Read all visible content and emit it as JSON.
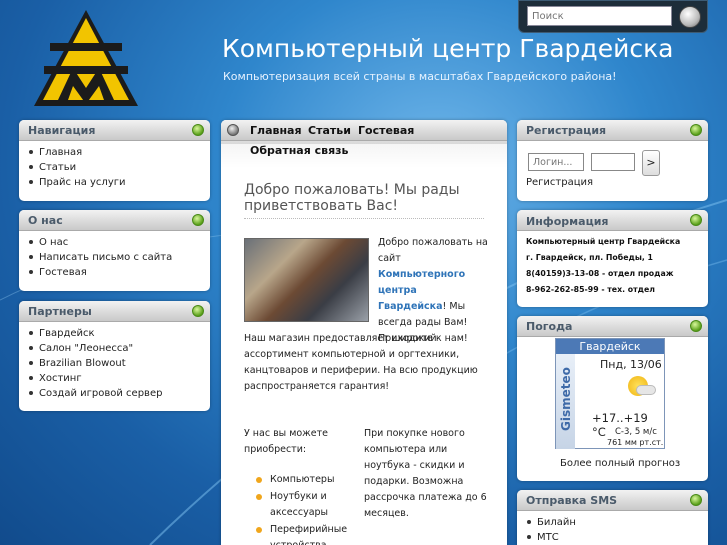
{
  "site": {
    "title": "Компьютерный центр Гвардейска",
    "subtitle": "Компьютеризация всей страны в масштабах Гвардейского района!"
  },
  "search": {
    "placeholder": "Поиск"
  },
  "nav_box": {
    "title": "Навигация",
    "items": [
      "Главная",
      "Статьи",
      "Прайс на услуги"
    ]
  },
  "about_box": {
    "title": "О нас",
    "items": [
      "О нас",
      "Написать письмо с сайта",
      "Гостевая"
    ]
  },
  "partners_box": {
    "title": "Партнеры",
    "items": [
      "Гвардейск",
      "Салон \"Леонесса\"",
      "Brazilian Blowout",
      "Хостинг",
      "Создай игровой сервер"
    ]
  },
  "main_nav": {
    "items": [
      "Главная",
      "Статьи",
      "Гостевая",
      "Обратная связь"
    ]
  },
  "article": {
    "heading": "Добро пожаловать! Мы рады приветствовать Вас!",
    "intro_before": "Добро пожаловать на сайт ",
    "intro_link": "Компьютерного центра Гвардейска",
    "intro_after": "! Мы всегда рады Вам! Приходите к нам!",
    "para2": "Наш магазин предоставляет широкий ассортимент компьютерной и оргтехники, канцтоваров и периферии. На всю продукцию распространяется гарантия!",
    "buy_heading": "У нас вы можете приобрести:",
    "buy_items": [
      "Компьютеры",
      "Ноутбуки и аксессуары",
      "Перефирийные устройства"
    ],
    "promo": "При покупке нового компьютера или ноутбука - скидки и подарки. Возможна рассрочка платежа до 6 месяцев."
  },
  "registration": {
    "title": "Регистрация",
    "login_placeholder": "Логин...",
    "go_label": ">",
    "link": "Регистрация"
  },
  "info": {
    "title": "Информация",
    "lines": [
      "Компьютерный центр Гвардейска",
      "г. Гвардейск, пл. Победы, 1",
      "8(40159)3-13-08 - отдел продаж",
      "8-962-262-85-99 - тех. отдел"
    ]
  },
  "weather": {
    "title": "Погода",
    "city": "Гвардейск",
    "date": "Пнд, 13/06",
    "brand": "Gismeteo",
    "temp": "+17..+19 °C",
    "wind": "С-3, 5 м/с",
    "pressure": "761 мм рт.ст.",
    "more": "Более полный прогноз"
  },
  "sms": {
    "title": "Отправка SMS",
    "items": [
      "Билайн",
      "МТС"
    ]
  },
  "colors": {
    "accent_link": "#2f74b8",
    "promo_text": "#c0392b",
    "header_dot": "#5aa01a"
  }
}
